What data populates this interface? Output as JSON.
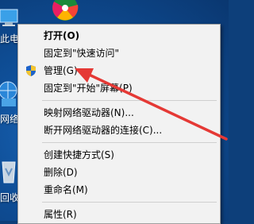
{
  "desktop": {
    "icon_this_pc_label": "此电",
    "icon_network_label": "网络",
    "icon_recycle_label": "回收"
  },
  "context_menu": {
    "items": [
      {
        "label": "打开(O)"
      },
      {
        "label": "固定到\"快速访问\""
      },
      {
        "label": "管理(G)"
      },
      {
        "label": "固定到\"开始\"屏幕(P)"
      },
      {
        "label": "映射网络驱动器(N)..."
      },
      {
        "label": "断开网络驱动器的连接(C)..."
      },
      {
        "label": "创建快捷方式(S)"
      },
      {
        "label": "删除(D)"
      },
      {
        "label": "重命名(M)"
      },
      {
        "label": "属性(R)"
      }
    ]
  },
  "annotation": {
    "arrow_color": "#e53935"
  },
  "icons": {
    "manage_icon": "shield-icon"
  }
}
